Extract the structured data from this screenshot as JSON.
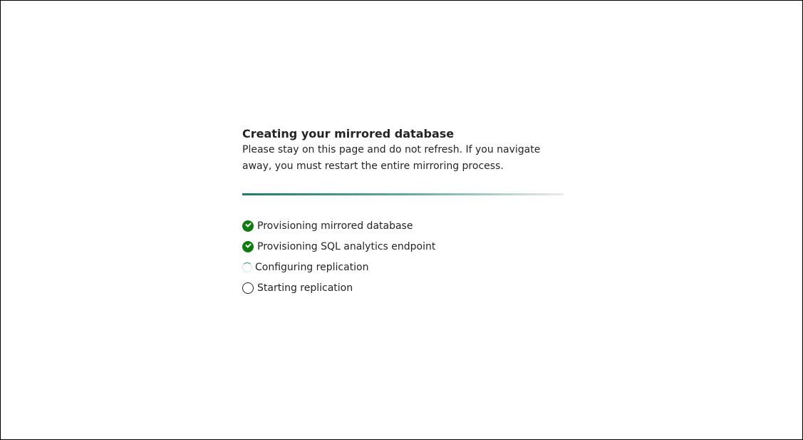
{
  "dialog": {
    "title": "Creating your mirrored database",
    "message": "Please stay on this page and do not refresh. If you navigate away, you must restart the entire mirroring process."
  },
  "progress": {
    "color": "#1f7a6c"
  },
  "steps": [
    {
      "label": "Provisioning mirrored database",
      "status": "completed",
      "icon": "checkmark-circle-icon"
    },
    {
      "label": "Provisioning SQL analytics endpoint",
      "status": "completed",
      "icon": "checkmark-circle-icon"
    },
    {
      "label": "Configuring replication",
      "status": "in-progress",
      "icon": "spinner-icon"
    },
    {
      "label": "Starting replication",
      "status": "pending",
      "icon": "empty-circle-icon"
    }
  ],
  "colors": {
    "success": "#107c10",
    "text": "#242424",
    "track": "#ebebeb"
  }
}
